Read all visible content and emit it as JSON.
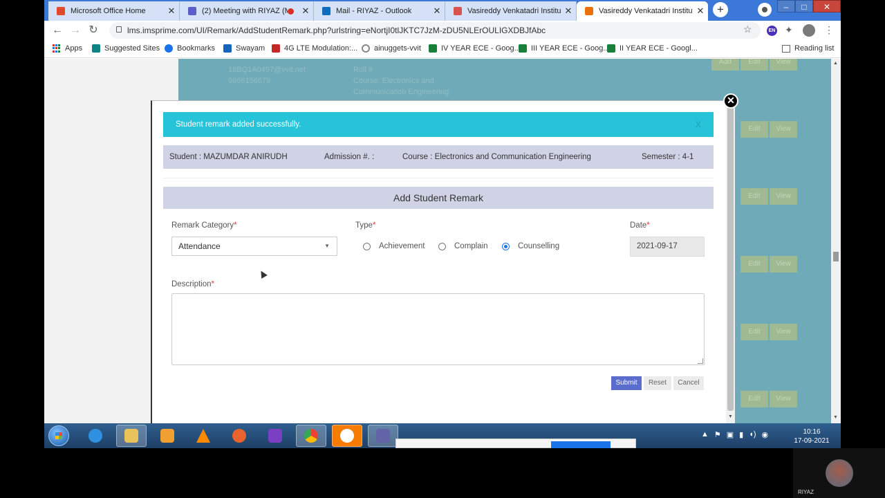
{
  "browser": {
    "tabs": [
      {
        "label": "Microsoft Office Home",
        "icon": "office-icon",
        "color": "#e04a2f",
        "recording": false
      },
      {
        "label": "(2) Meeting with RIYAZ (M",
        "icon": "teams-icon",
        "color": "#5b5fc7",
        "recording": true
      },
      {
        "label": "Mail - RIYAZ - Outlook",
        "icon": "outlook-icon",
        "color": "#0f6cbd",
        "recording": false
      },
      {
        "label": "Vasireddy Venkatadri Institute",
        "icon": "calendar-icon",
        "color": "#d9534f",
        "recording": false
      },
      {
        "label": "Vasireddy Venkatadri Institute",
        "icon": "vvit-icon",
        "color": "#e8710a",
        "recording": false
      }
    ],
    "close_glyph": "✕",
    "new_tab_glyph": "+",
    "window_controls": {
      "minimize": "–",
      "maximize": "□",
      "close": "✕"
    },
    "nav": {
      "back": "←",
      "forward": "→",
      "reload": "↻"
    },
    "url": "lms.imsprime.com/UI/Remark/AddStudentRemark.php?urlstring=eNortjI0tlJKTC7JzM-zDU5NLErOULIGXDBJfAbc",
    "bookmark_star": "☆",
    "extension_en": "EN",
    "extension_puzzle": "✦",
    "menu_glyph": "⋮",
    "bookmarks": [
      {
        "label": "Apps",
        "icon": "apps-grid-icon",
        "color": ""
      },
      {
        "label": "Suggested Sites",
        "icon": "bing-icon",
        "color": "#0c8484"
      },
      {
        "label": "Bookmarks",
        "icon": "star-icon",
        "color": "#1a73e8"
      },
      {
        "label": "Swayam",
        "icon": "swayam-icon",
        "color": "#1565c0"
      },
      {
        "label": "4G LTE Modulation:...",
        "icon": "m-icon",
        "color": "#c62828"
      },
      {
        "label": "ainuggets-vvit",
        "icon": "circle-icon",
        "color": "#888888"
      },
      {
        "label": "IV YEAR ECE - Goog...",
        "icon": "sheets-icon",
        "color": "#188038"
      },
      {
        "label": "III YEAR ECE - Goog...",
        "icon": "sheets-icon",
        "color": "#188038"
      },
      {
        "label": "II YEAR ECE - Googl...",
        "icon": "sheets-icon",
        "color": "#188038"
      }
    ],
    "reading_list": "Reading list"
  },
  "background_row": {
    "student_lines": [
      "18BQ1A0497@vvit.net",
      "9866156679"
    ],
    "course_lines": [
      "Roll #",
      "Course: Electronics and",
      "Communication Engineering"
    ],
    "buttons": [
      "Add",
      "Edit",
      "View"
    ],
    "row_buttons": [
      "Edit",
      "View"
    ]
  },
  "modal": {
    "close_glyph": "✕",
    "alert": {
      "message": "Student remark added successfully.",
      "dismiss": "X"
    },
    "info": {
      "student": "Student : MAZUMDAR ANIRUDH",
      "admission": "Admission #. :",
      "course": "Course : Electronics and Communication Engineering",
      "semester": "Semester : 4-1"
    },
    "form": {
      "title": "Add Student Remark",
      "required_mark": "*",
      "category_label": "Remark Category",
      "category_value": "Attendance",
      "category_caret": "▼",
      "type_label": "Type",
      "type_options": [
        {
          "label": "Achievement",
          "checked": false
        },
        {
          "label": "Complain",
          "checked": false
        },
        {
          "label": "Counselling",
          "checked": true
        }
      ],
      "date_label": "Date",
      "date_value": "2021-09-17",
      "description_label": "Description",
      "description_value": "",
      "submit": "Submit",
      "reset": "Reset",
      "cancel": "Cancel"
    }
  },
  "taskbar": {
    "apps": [
      {
        "name": "internet-explorer-icon",
        "color": "#2f8fe0",
        "active": false
      },
      {
        "name": "file-explorer-icon",
        "color": "#e8c25a",
        "active": true
      },
      {
        "name": "media-player-icon",
        "color": "#f0a030",
        "active": false
      },
      {
        "name": "vlc-icon",
        "color": "#ff8a00",
        "active": false
      },
      {
        "name": "firefox-icon",
        "color": "#e8632e",
        "active": false
      },
      {
        "name": "visual-studio-icon",
        "color": "#7b3fc4",
        "active": false
      },
      {
        "name": "chrome-icon",
        "color": "#34a853",
        "active": true
      },
      {
        "name": "pdf-app-icon",
        "color": "#f57c00",
        "active": true
      },
      {
        "name": "teams-app-icon",
        "color": "#6264a7",
        "active": true
      }
    ],
    "tray_glyphs": [
      "▲",
      "⚑",
      "▣",
      "▮",
      "◖)",
      "◉"
    ],
    "time": "10:16",
    "date": "17-09-2021"
  },
  "participant": {
    "name": "RIYAZ"
  }
}
